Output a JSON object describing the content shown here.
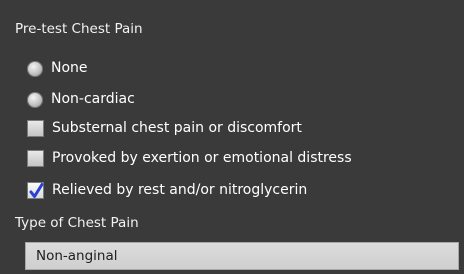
{
  "chest_pain": {
    "title": "Pre-test Chest Pain",
    "options": [
      {
        "type": "radio",
        "label": "None",
        "selected": false
      },
      {
        "type": "radio",
        "label": "Non-cardiac",
        "selected": false
      },
      {
        "type": "checkbox",
        "label": "Substernal chest pain or discomfort",
        "checked": false
      },
      {
        "type": "checkbox",
        "label": "Provoked by exertion or emotional distress",
        "checked": false
      },
      {
        "type": "checkbox",
        "label": "Relieved by rest and/or nitroglycerin",
        "checked": true
      }
    ]
  },
  "type_of_chest_pain": {
    "title": "Type of Chest Pain",
    "value": "Non-anginal"
  },
  "colors": {
    "panel_bg": "#3a3a3a",
    "check_mark": "#2a3fd6"
  }
}
